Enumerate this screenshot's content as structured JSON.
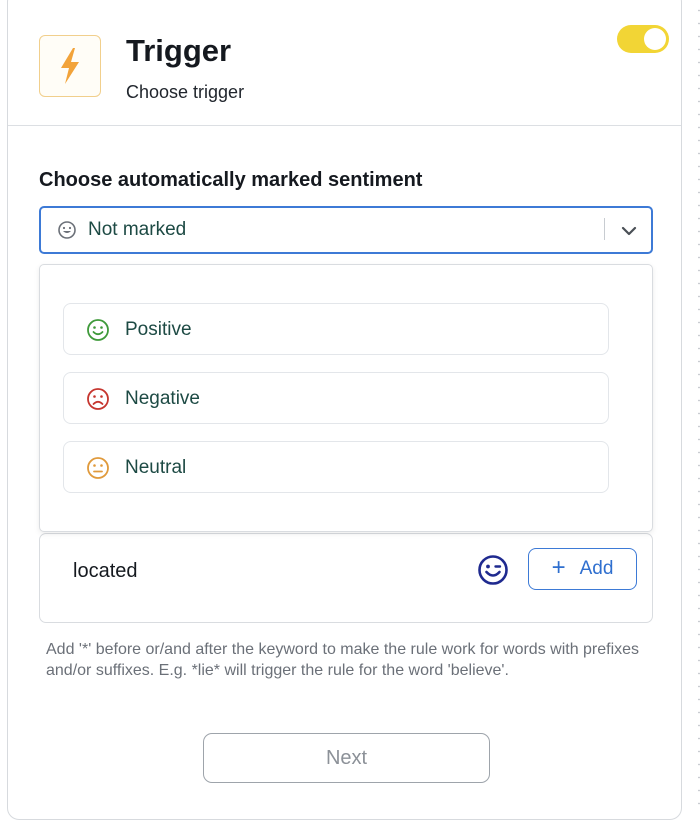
{
  "header": {
    "title": "Trigger",
    "subtitle": "Choose trigger",
    "icon": "lightning-icon",
    "toggle_on": true
  },
  "sentiment": {
    "label": "Choose automatically marked sentiment",
    "selected_value": "Not marked",
    "options": [
      {
        "label": "Positive",
        "icon": "smile-icon",
        "color": "#3f9a3b"
      },
      {
        "label": "Negative",
        "icon": "frown-icon",
        "color": "#c6362f"
      },
      {
        "label": "Neutral",
        "icon": "neutral-face-icon",
        "color": "#e09a3c"
      }
    ]
  },
  "keyword": {
    "value": "located",
    "add_label": "Add"
  },
  "hint": "Add '*' before or/and after the keyword to make the rule work for words with prefixes and/or suffixes. E.g. *lie* will trigger the rule for the word 'believe'.",
  "next_label": "Next",
  "colors": {
    "accent": "#3d7ad6",
    "toggle": "#f2d535",
    "trigger_icon": "#f2a33a"
  }
}
